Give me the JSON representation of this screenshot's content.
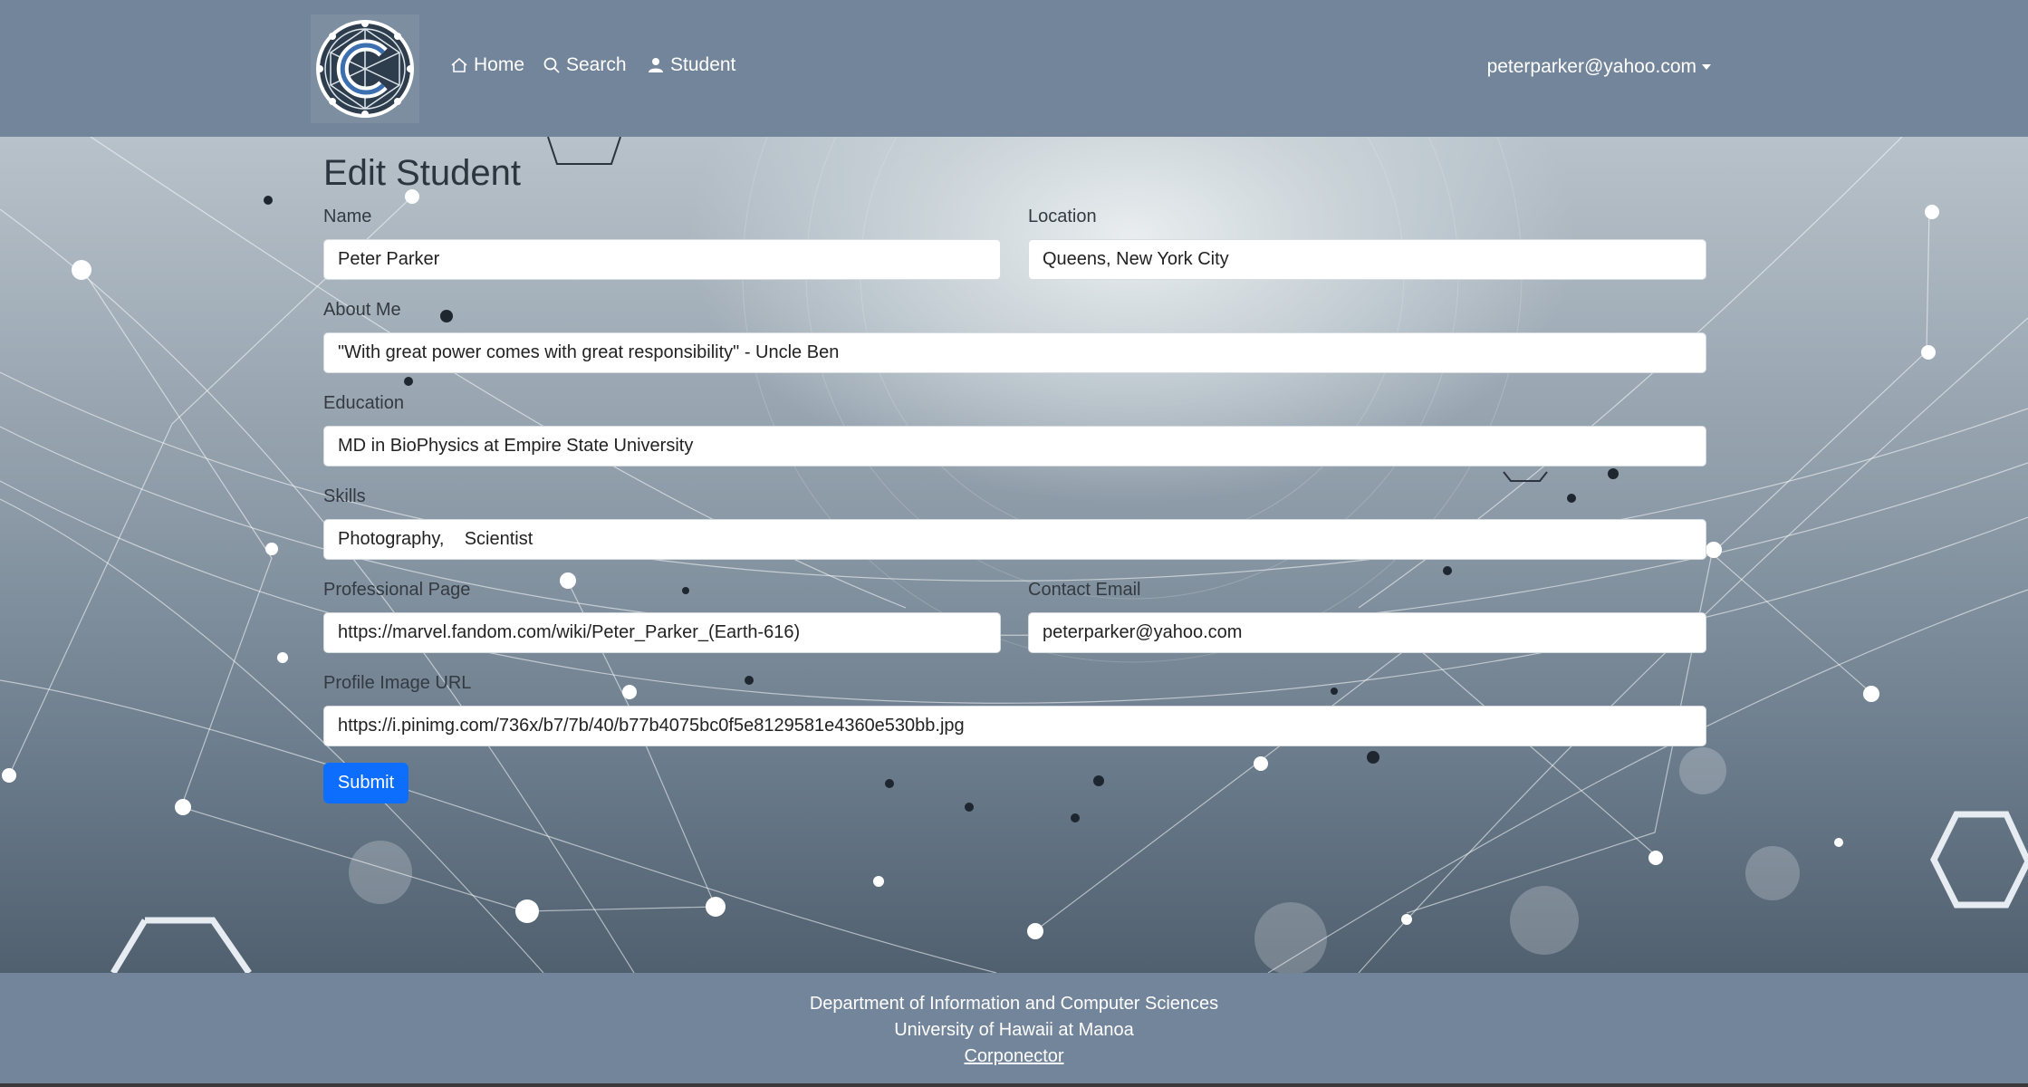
{
  "nav": {
    "home": "Home",
    "search": "Search",
    "student": "Student",
    "user": "peterparker@yahoo.com"
  },
  "page": {
    "title": "Edit Student",
    "submit": "Submit"
  },
  "form": {
    "name_label": "Name",
    "name_value": "Peter Parker",
    "location_label": "Location",
    "location_value": "Queens, New York City",
    "about_label": "About Me",
    "about_value": "\"With great power comes with great responsibility\" - Uncle Ben",
    "education_label": "Education",
    "education_value": "MD in BioPhysics at Empire State University",
    "skills_label": "Skills",
    "skills_value": "Photography,    Scientist",
    "professional_label": "Professional Page",
    "professional_value": "https://marvel.fandom.com/wiki/Peter_Parker_(Earth-616)",
    "contact_label": "Contact Email",
    "contact_value": "peterparker@yahoo.com",
    "image_label": "Profile Image URL",
    "image_value": "https://i.pinimg.com/736x/b7/7b/40/b77b4075bc0f5e8129581e4360e530bb.jpg"
  },
  "footer": {
    "line1": "Department of Information and Computer Sciences",
    "line2": "University of Hawaii at Manoa",
    "link": "Corponector"
  },
  "colors": {
    "navbar": "#73859a",
    "submit": "#0d6efd"
  }
}
